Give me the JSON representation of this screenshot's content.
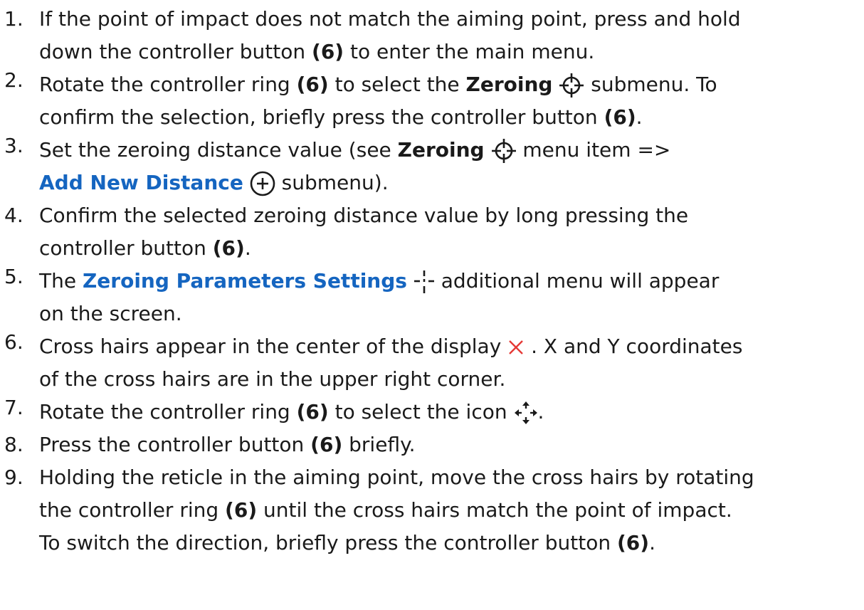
{
  "steps": [
    {
      "n": "1.",
      "a": "If the point of impact does not match the aiming point, press and hold",
      "b": "down the controller button ",
      "c": "(6)",
      "d": " to enter the main menu."
    },
    {
      "n": "2.",
      "a": "Rotate the controller ring ",
      "b": "(6)",
      "c": " to select the ",
      "d": "Zeroing",
      "e": " submenu. To",
      "f": "confirm the selection, briefly press the controller button ",
      "g": "(6)",
      "h": "."
    },
    {
      "n": "3.",
      "a": "Set the zeroing distance value (see ",
      "b": "Zeroing",
      "c": " menu item =>",
      "d": "Add New Distance",
      "e": " submenu)."
    },
    {
      "n": "4.",
      "a": "Confirm the selected zeroing distance value by long pressing the",
      "b": "controller button ",
      "c": "(6)",
      "d": "."
    },
    {
      "n": "5.",
      "a": "The ",
      "b": "Zeroing Parameters Settings",
      "c": " additional menu will appear",
      "d": "on the screen."
    },
    {
      "n": "6.",
      "a": "Cross hairs appear in the center of the display ",
      "b": " . X and Y coordinates",
      "c": "of the cross hairs are in the upper right corner."
    },
    {
      "n": "7.",
      "a": "Rotate the controller ring ",
      "b": "(6)",
      "c": " to select the icon ",
      "d": "."
    },
    {
      "n": "8.",
      "a": "Press the controller button ",
      "b": "(6)",
      "c": " briefly."
    },
    {
      "n": "9.",
      "a": "Holding the reticle in the aiming point, move the cross hairs by rotating",
      "b": "the controller ring ",
      "c": "(6)",
      "d": " until the cross hairs match the point of impact.",
      "e": "To switch the direction, briefly press the controller button ",
      "f": "(6)",
      "g": "."
    }
  ],
  "icons": {
    "zeroing": "crosshair-target-icon",
    "add_distance": "plus-circle-icon",
    "zeroing_params": "dashed-cross-icon",
    "display_cross": "red-x-icon",
    "move": "move-arrows-icon"
  },
  "colors": {
    "text": "#1a1a1a",
    "link": "#1565c0",
    "cross": "#e53935"
  }
}
